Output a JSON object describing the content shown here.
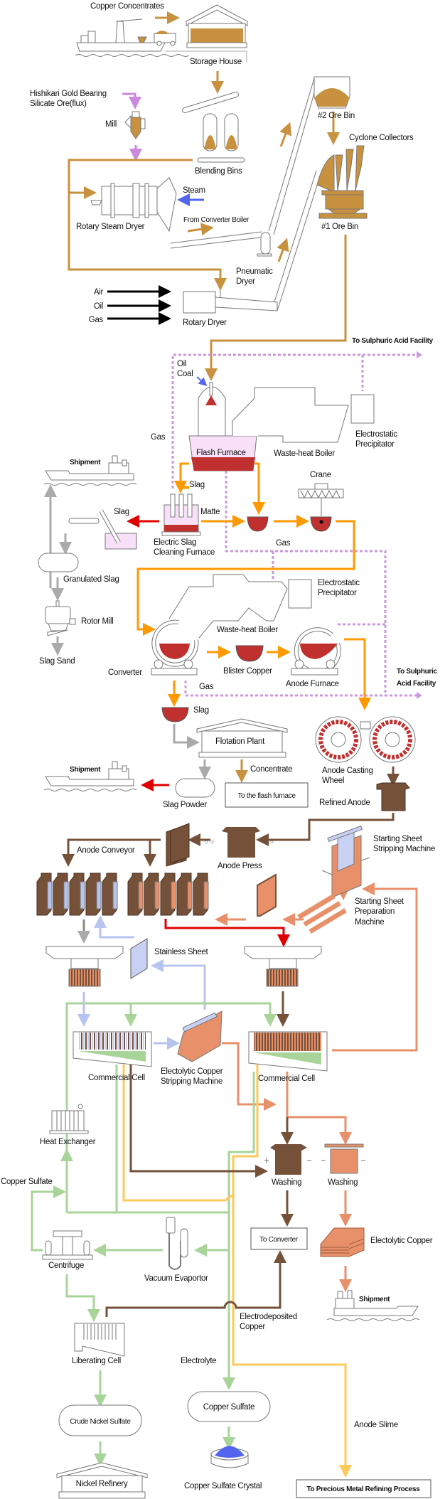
{
  "colors": {
    "ore_flow": "#c8913f",
    "flux_flow": "#cc88dd",
    "gas_flow": "#cc99dd",
    "matte_flow": "#ff9900",
    "slag_flow": "#e00000",
    "byproduct_flow": "#aaaaaa",
    "anode": "#76513a",
    "cathode": "#e8906a",
    "stainless": "#b8c4f0",
    "electrolyte": "#a8d49a",
    "slime": "#ffc95a",
    "molten": "#c0302f",
    "steam": "#5566ee"
  },
  "labels": {
    "copper_concentrates": "Copper Concentrates",
    "storage_house": "Storage House",
    "hishikari_1": "Hishikari Gold Bearing",
    "hishikari_2": "Silicate Ore(flux)",
    "mill": "Mill",
    "blending_bins": "Blending Bins",
    "ore_bin_2": "#2 Ore Bin",
    "cyclone_collectors": "Cyclone Collectors",
    "steam": "Steam",
    "from_converter_boiler": "From Converter Boiler",
    "rotary_steam_dryer": "Rotary Steam Dryer",
    "ore_bin_1": "#1 Ore Bin",
    "pneumatic_dryer_1": "Pneumatic",
    "pneumatic_dryer_2": "Dryer",
    "air": "Air",
    "oil": "Oil",
    "gas": "Gas",
    "rotary_dryer": "Rotary Dryer",
    "to_sulphuric_1": "To Sulphuric Acid Facility",
    "oil_burner": "Oil",
    "coal_burner": "Coal",
    "gas_1": "Gas",
    "flash_furnace": "Flash Furnace",
    "waste_heat_boiler_1": "Waste-heat Boiler",
    "esp_1a": "Electrostatic",
    "esp_1b": "Precipitator",
    "shipment_1": "Shipment",
    "slag_1": "Slag",
    "crane": "Crane",
    "slag_2": "Slag",
    "matte": "Matte",
    "electric_slag_1": "Electric Slag",
    "electric_slag_2": "Cleaning Furnace",
    "gas_2": "Gas",
    "granulated_slag": "Granulated Slag",
    "esp_2a": "Electrostatic",
    "esp_2b": "Precipitator",
    "rotor_mill": "Rotor Mill",
    "waste_heat_boiler_2": "Waste-heat Boiler",
    "slag_sand": "Slag Sand",
    "converter": "Converter",
    "blister_copper": "Blister Copper",
    "anode_furnace": "Anode Furnace",
    "to_sulphuric_2a": "To Sulphuric",
    "to_sulphuric_2b": "Acid Facility",
    "gas_3": "Gas",
    "slag_3": "Slag",
    "flotation_plant": "Flotation Plant",
    "shipment_2": "Shipment",
    "concentrate": "Concentrate",
    "anode_casting_1": "Anode Casting",
    "anode_casting_2": "Wheel",
    "to_flash_furnace": "To the flash furnace",
    "slag_powder": "Slag Powder",
    "refined_anode": "Refined Anode",
    "anode_conveyor": "Anode Conveyor",
    "sss_1": "Starting Sheet",
    "sss_2": "Stripping Machine",
    "anode_press": "Anode Press",
    "ssp_1": "Starting Sheet",
    "ssp_2": "Preparation",
    "ssp_3": "Machine",
    "stainless_sheet": "Stainless Sheet",
    "commercial_cell_1": "Commercial Cell",
    "ecsm_1": "Electolytic Copper",
    "ecsm_2": "Stripping Machine",
    "commercial_cell_2": "Commercial Cell",
    "heat_exchanger": "Heat Exchanger",
    "copper_sulfate_side": "Copper Sulfate",
    "washing_1": "Washing",
    "washing_2": "Washing",
    "to_converter": "To Converter",
    "electolytic_copper": "Electolytic Copper",
    "centrifuge": "Centrifuge",
    "vacuum_evaporator": "Vacuum Evaportor",
    "shipment_3": "Shipment",
    "electrodeposited_1": "Electrodeposited",
    "electrodeposited_2": "Copper",
    "liberating_cell": "Liberating Cell",
    "electrolyte": "Electrolyte",
    "copper_sulfate": "Copper Sulfate",
    "crude_nickel_sulfate": "Crude Nickel Sulfate",
    "anode_slime": "Anode Slime",
    "nickel_refinery": "Nickel Refinery",
    "copper_sulfate_crystal": "Copper Sulfate Crystal",
    "precious_metal": "To Precious Metal Refining Process"
  }
}
